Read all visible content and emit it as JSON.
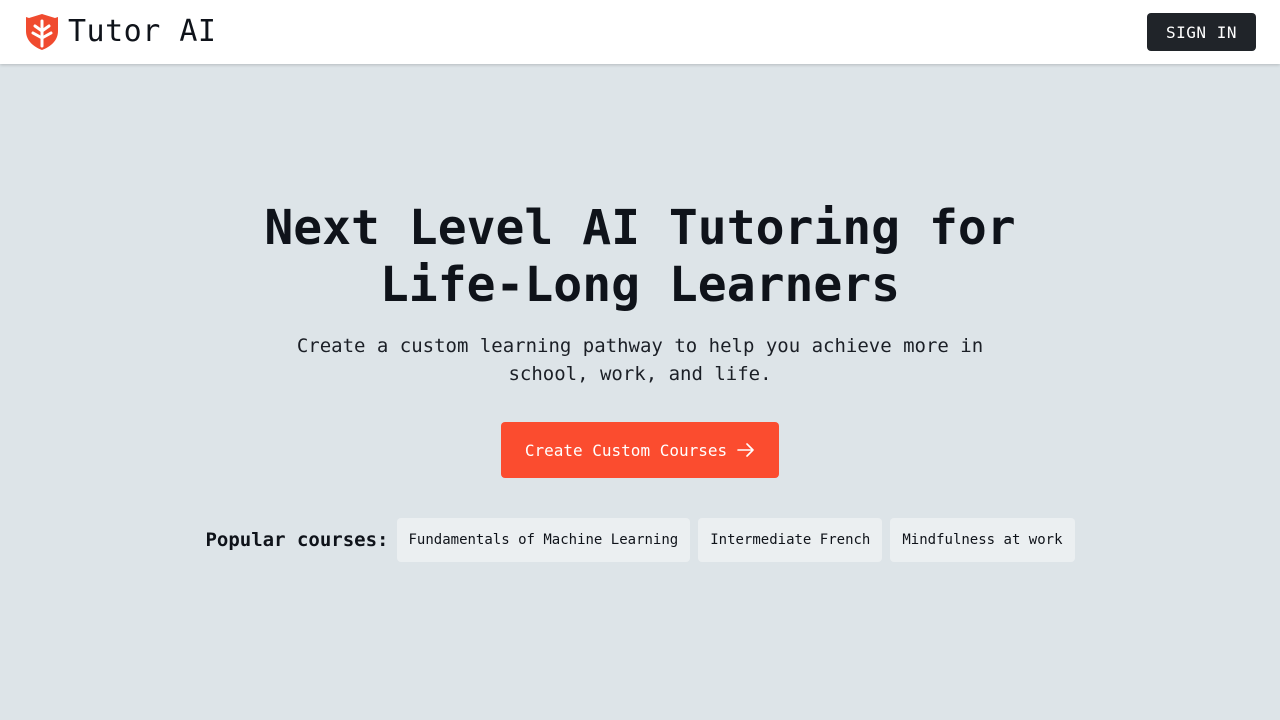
{
  "brand": {
    "name": "Tutor AI",
    "logo_icon": "shield-icon",
    "logo_color": "#f04b2f"
  },
  "header": {
    "signin_label": "SIGN IN"
  },
  "hero": {
    "title": "Next Level AI Tutoring for Life-Long Learners",
    "subtitle": "Create a custom learning pathway to help you achieve more in school, work, and life.",
    "cta_label": "Create Custom Courses",
    "cta_icon": "arrow-right-icon"
  },
  "popular": {
    "label": "Popular courses:",
    "courses": [
      "Fundamentals of Machine Learning",
      "Intermediate French",
      "Mindfulness at work"
    ]
  },
  "colors": {
    "background": "#dde4e8",
    "accent": "#fb4c2f",
    "dark_button": "#202429",
    "chip": "#ebeff1"
  }
}
